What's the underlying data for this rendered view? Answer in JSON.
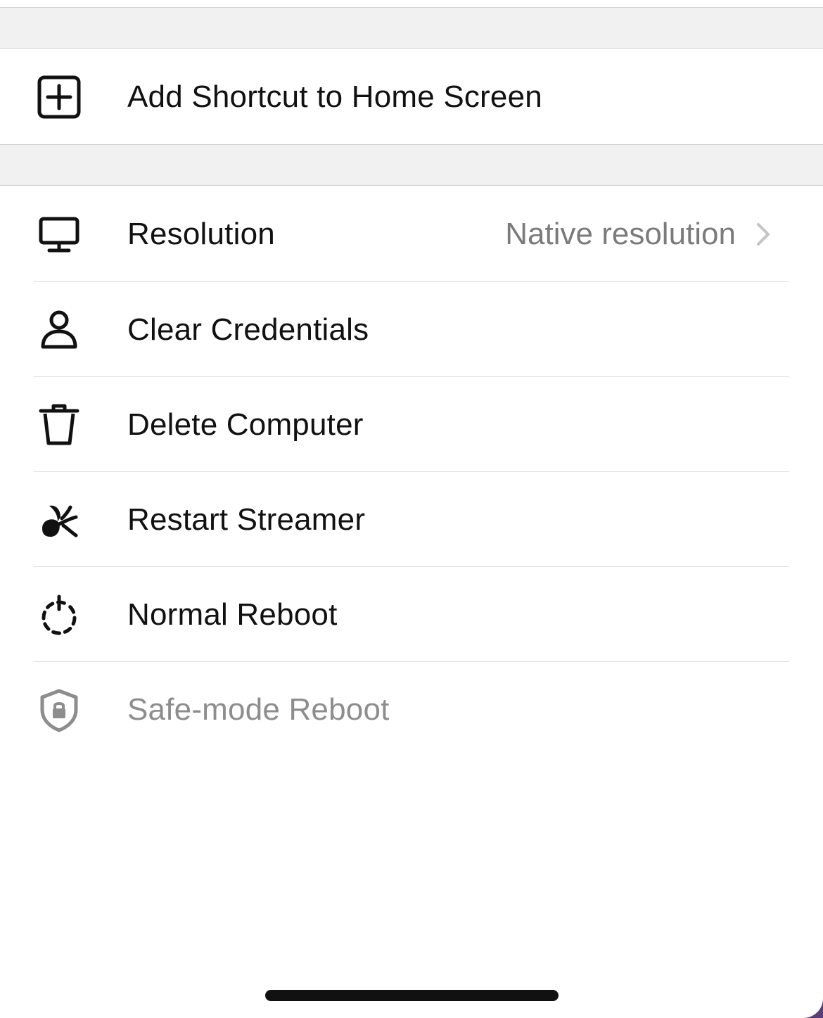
{
  "shortcut_section": {
    "add_shortcut_label": "Add Shortcut to Home Screen",
    "add_shortcut_icon": "plus-square-icon"
  },
  "settings": {
    "resolution": {
      "label": "Resolution",
      "value": "Native resolution",
      "icon": "monitor-icon"
    },
    "clear_credentials": {
      "label": "Clear Credentials",
      "icon": "person-icon"
    },
    "delete_computer": {
      "label": "Delete Computer",
      "icon": "trash-icon"
    },
    "restart_streamer": {
      "label": "Restart Streamer",
      "icon": "sprout-icon"
    },
    "normal_reboot": {
      "label": "Normal Reboot",
      "icon": "power-dashed-icon"
    },
    "safe_mode_reboot": {
      "label": "Safe-mode Reboot",
      "icon": "shield-lock-icon",
      "disabled": true
    }
  },
  "colors": {
    "primary_text": "#111111",
    "secondary_text": "#7b7b7b",
    "disabled_text": "#8d8d8d",
    "section_background": "#f1f1f1"
  }
}
